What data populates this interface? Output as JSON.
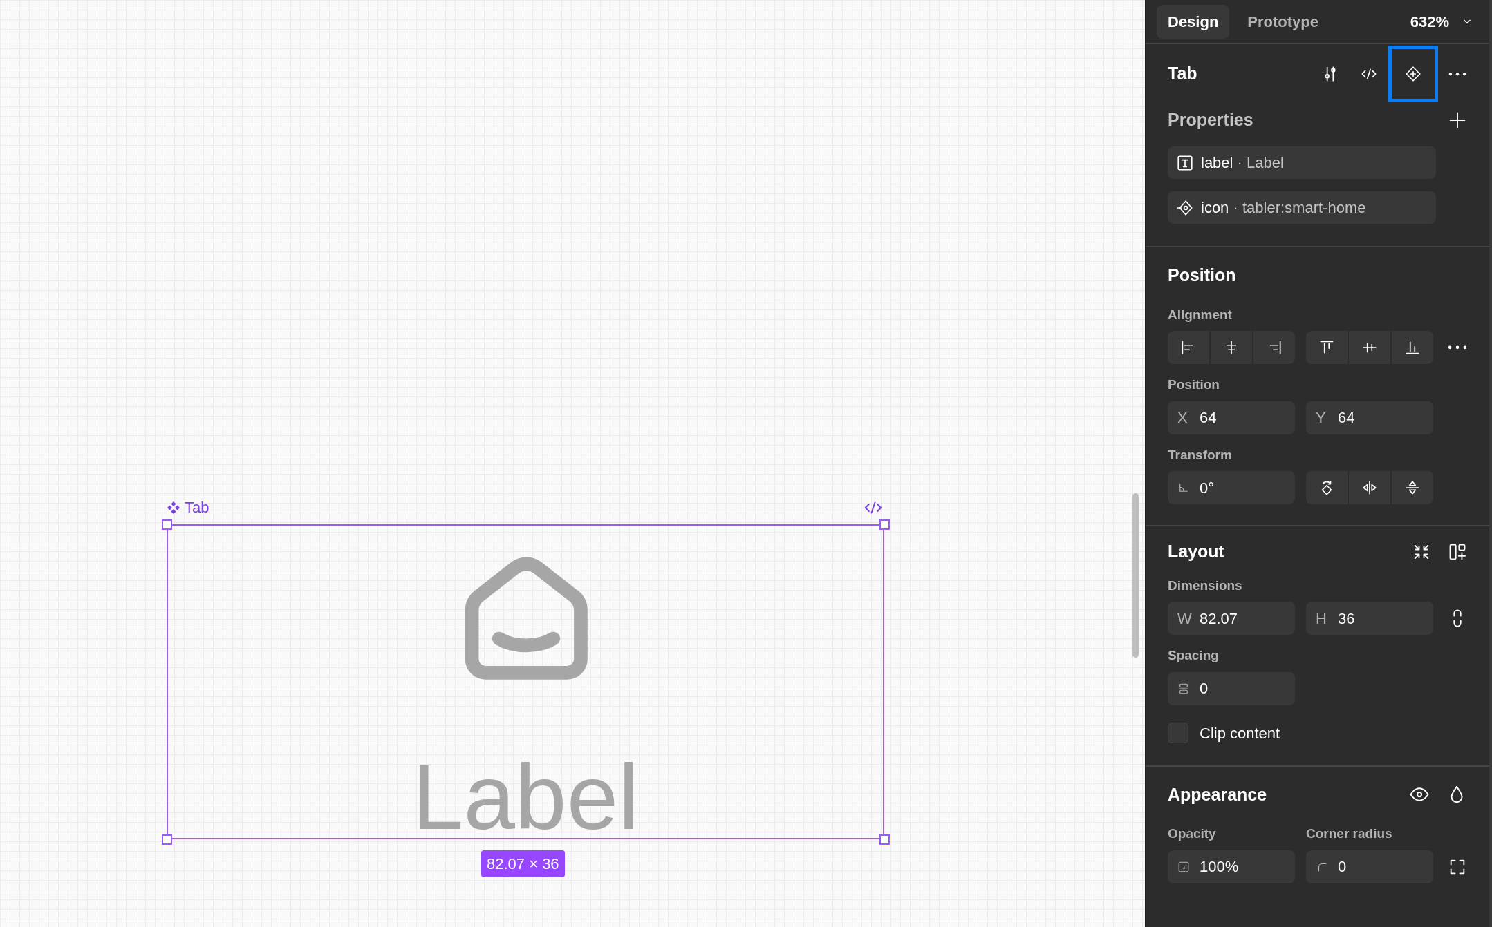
{
  "canvas": {
    "frame": {
      "name": "Tab",
      "text": "Label",
      "size": "82.07 × 36",
      "selected": true
    }
  },
  "panel": {
    "tabs": [
      {
        "label": "Design",
        "selected": true
      },
      {
        "label": "Prototype",
        "selected": false
      }
    ],
    "zoom": "632%",
    "header": {
      "title": "Tab",
      "tools": [
        {
          "kind": "sliders",
          "highlighted": false
        },
        {
          "kind": "code",
          "highlighted": false
        },
        {
          "kind": "component",
          "highlighted": true
        },
        {
          "kind": "more",
          "highlighted": false
        }
      ]
    },
    "properties": {
      "title": "Properties",
      "items": [
        {
          "kind": "text",
          "name": "label",
          "separator": "·",
          "value": "Label"
        },
        {
          "kind": "instance",
          "name": "icon",
          "separator": "·",
          "value": "tabler:smart-home"
        }
      ]
    },
    "position": {
      "title": "Position",
      "alignment": {
        "label": "Alignment",
        "groups": [
          [
            {
              "kind": "align-left"
            },
            {
              "kind": "align-hcenter"
            },
            {
              "kind": "align-right"
            }
          ],
          [
            {
              "kind": "align-top"
            },
            {
              "kind": "align-vcenter"
            },
            {
              "kind": "align-bottom"
            }
          ]
        ]
      },
      "position": {
        "label": "Position",
        "fields": [
          {
            "prefix": "X",
            "value": "64"
          },
          {
            "prefix": "Y",
            "value": "64"
          }
        ]
      },
      "transform": {
        "label": "Transform",
        "field": {
          "kind": "rotation",
          "value": "0°"
        },
        "buttons": [
          {
            "kind": "rotate"
          },
          {
            "kind": "flip-h"
          },
          {
            "kind": "flip-v"
          }
        ]
      }
    },
    "layout": {
      "title": "Layout",
      "dimensions": {
        "label": "Dimensions",
        "fields": [
          {
            "prefix": "W",
            "value": "82.07"
          },
          {
            "prefix": "H",
            "value": "36"
          }
        ]
      },
      "spacing": {
        "label": "Spacing",
        "field": {
          "kind": "gap",
          "value": "0"
        }
      },
      "clip_content": {
        "label": "Clip content",
        "checked": false
      }
    },
    "appearance": {
      "title": "Appearance",
      "opacity": {
        "label": "Opacity",
        "field": {
          "kind": "opacity",
          "value": "100%"
        }
      },
      "corner_radius": {
        "label": "Corner radius",
        "field": {
          "kind": "radius",
          "value": "0"
        }
      }
    }
  }
}
